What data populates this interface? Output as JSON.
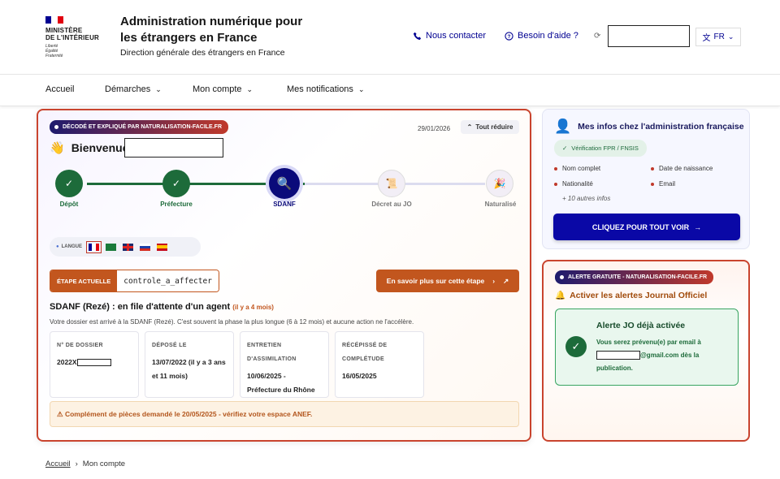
{
  "header": {
    "logo_line1": "MINISTÈRE",
    "logo_line2": "DE L'INTÉRIEUR",
    "logo_motto1": "Liberté",
    "logo_motto2": "Égalité",
    "logo_motto3": "Fraternité",
    "title": "Administration numérique pour les étrangers en France",
    "subtitle": "Direction générale des étrangers en France",
    "contact_label": "Nous contacter",
    "help_label": "Besoin d'aide ?",
    "lang_label": "FR"
  },
  "nav": {
    "items": [
      {
        "label": "Accueil"
      },
      {
        "label": "Démarches"
      },
      {
        "label": "Mon compte"
      },
      {
        "label": "Mes notifications"
      }
    ]
  },
  "main": {
    "badge": "DÉCODÉ ET EXPLIQUÉ PAR NATURALISATION-FACILE.FR",
    "date": "29/01/2026",
    "reduce_label": "Tout réduire",
    "welcome": "Bienvenue",
    "steps": [
      {
        "label": "Dépôt",
        "state": "done"
      },
      {
        "label": "Préfecture",
        "state": "done"
      },
      {
        "label": "SDANF",
        "state": "current"
      },
      {
        "label": "Décret au JO",
        "state": "todo"
      },
      {
        "label": "Naturalisé",
        "state": "todo"
      }
    ],
    "lang_label": "LANGUE",
    "current_step_tag": "ÉTAPE ACTUELLE",
    "current_step_value": "controle_a_affecter",
    "more_button": "En savoir plus sur cette étape",
    "status_title": "SDANF (Rezé) : en file d'attente d'un agent",
    "status_ago": "(il y a 4 mois)",
    "status_desc": "Votre dossier est arrivé à la SDANF (Rezé). C'est souvent la phase la plus longue (6 à 12 mois) et aucune action ne l'accélère.",
    "cards": [
      {
        "key": "N° DE DOSSIER",
        "value": "2022X"
      },
      {
        "key": "DÉPOSÉ LE",
        "value": "13/07/2022 (il y a 3 ans et 11 mois)"
      },
      {
        "key": "ENTRETIEN D'ASSIMILATION",
        "value": "10/06/2025 - Préfecture du Rhône"
      },
      {
        "key": "RÉCÉPISSÉ DE COMPLÉTUDE",
        "value": "16/05/2025"
      }
    ],
    "warning": "⚠ Complément de pièces demandé le 20/05/2025 - vérifiez votre espace ANEF."
  },
  "info": {
    "title": "Mes infos chez l'administration française",
    "verif": "Vérification FPR / FNSIS",
    "items": [
      "Nom complet",
      "Date de naissance",
      "Nationalité",
      "Email"
    ],
    "more": "+ 10 autres infos",
    "cta": "CLIQUEZ POUR TOUT VOIR"
  },
  "alert": {
    "badge": "ALERTE GRATUITE - NATURALISATION-FACILE.FR",
    "title": "Activer les alertes Journal Officiel",
    "box_title": "Alerte JO déjà activée",
    "box_text1": "Vous serez prévenu(e) par email à",
    "box_email_suffix": "@gmail.com",
    "box_text2": "dès la publication."
  },
  "breadcrumb": {
    "home": "Accueil",
    "current": "Mon compte"
  },
  "colors": {
    "brand_blue": "#000091",
    "accent_orange": "#c2561e",
    "step_green": "#1d6b3a",
    "step_current": "#0a0a7a",
    "alert_red": "#c9442e"
  }
}
